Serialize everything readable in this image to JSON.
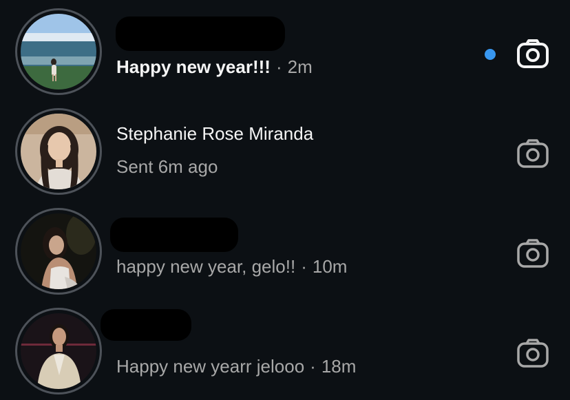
{
  "threads": [
    {
      "name": "",
      "message": "Happy new year!!!",
      "time": "2m",
      "unread": true,
      "avatar": "woman-on-beach-photo",
      "camera_icon": "camera-icon"
    },
    {
      "name": "Stephanie Rose Miranda",
      "message": "Sent 6m ago",
      "time": "",
      "unread": false,
      "avatar": "woman-portrait-photo",
      "camera_icon": "camera-icon"
    },
    {
      "name": "",
      "message": "happy new year, gelo!!",
      "time": "10m",
      "unread": false,
      "avatar": "woman-night-photo",
      "camera_icon": "camera-icon"
    },
    {
      "name": "",
      "message": "Happy new yearr jelooo",
      "time": "18m",
      "unread": false,
      "avatar": "woman-blazer-photo",
      "camera_icon": "camera-icon"
    }
  ],
  "separator": "·",
  "colors": {
    "background": "#0c1014",
    "unread_dot": "#3897f0",
    "text_primary": "#f5f5f5",
    "text_secondary": "#a8a8a8"
  }
}
